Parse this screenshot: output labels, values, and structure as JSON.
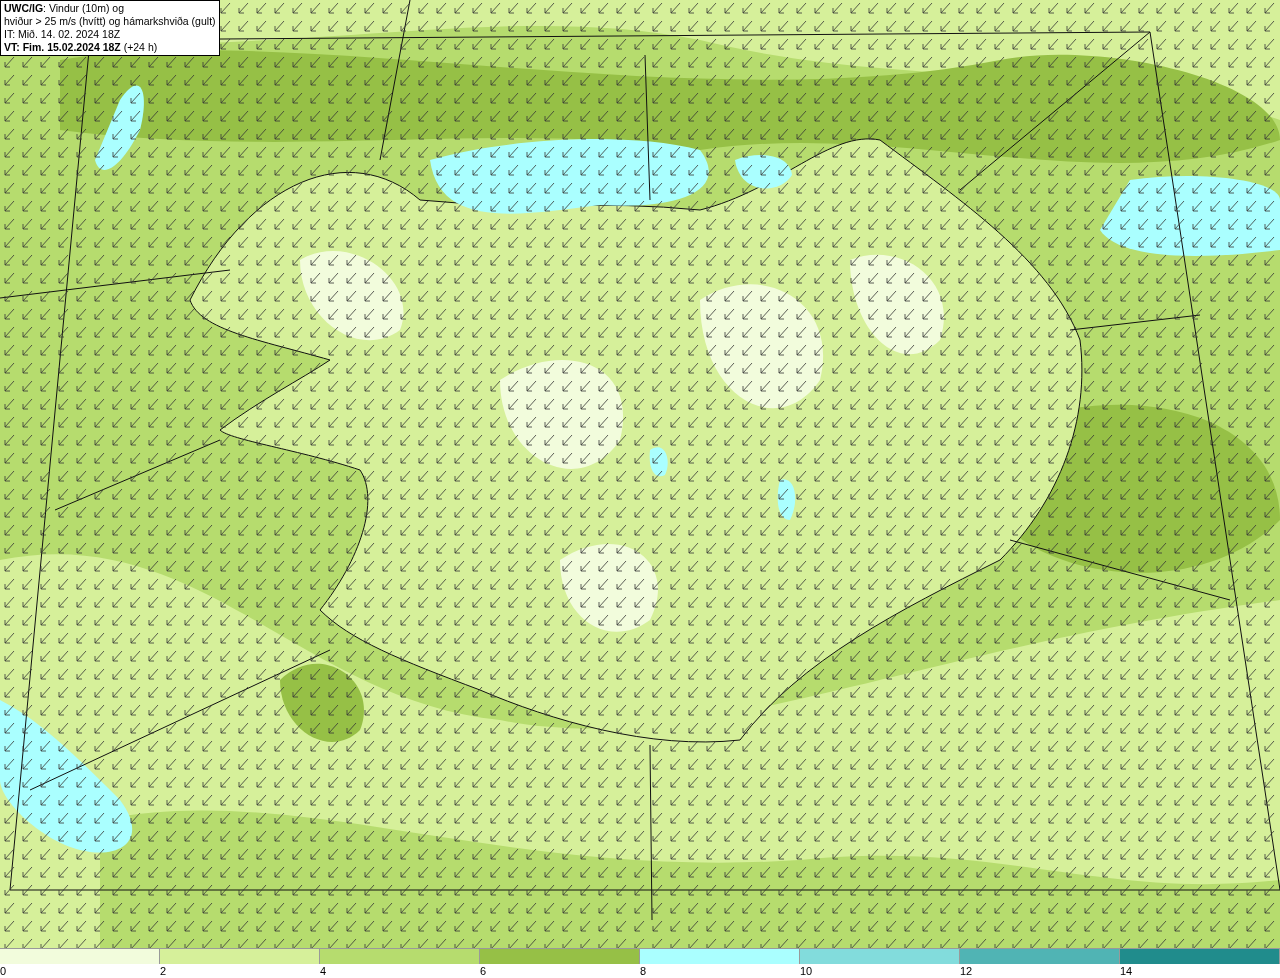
{
  "title_box": {
    "lines": [
      "**UWC/IG**: Vindur (10m) og",
      "hviður > 25 m/s (hvítt) og hámarkshviða (gult)",
      "IT: Mið. 14. 02. 2024 18Z",
      "**VT: Fim. 15.02.2024 18Z** (+24 h)"
    ]
  },
  "legend": {
    "bins": [
      {
        "color": "#f2fcdc"
      },
      {
        "color": "#d6f09a"
      },
      {
        "color": "#b6dc6e"
      },
      {
        "color": "#96c046"
      },
      {
        "color": "#aaffff"
      },
      {
        "color": "#82dcdc"
      },
      {
        "color": "#50b4b4"
      },
      {
        "color": "#208c8c"
      }
    ],
    "ticks": [
      "0",
      "2",
      "4",
      "6",
      "8",
      "10",
      "12",
      "14"
    ]
  }
}
